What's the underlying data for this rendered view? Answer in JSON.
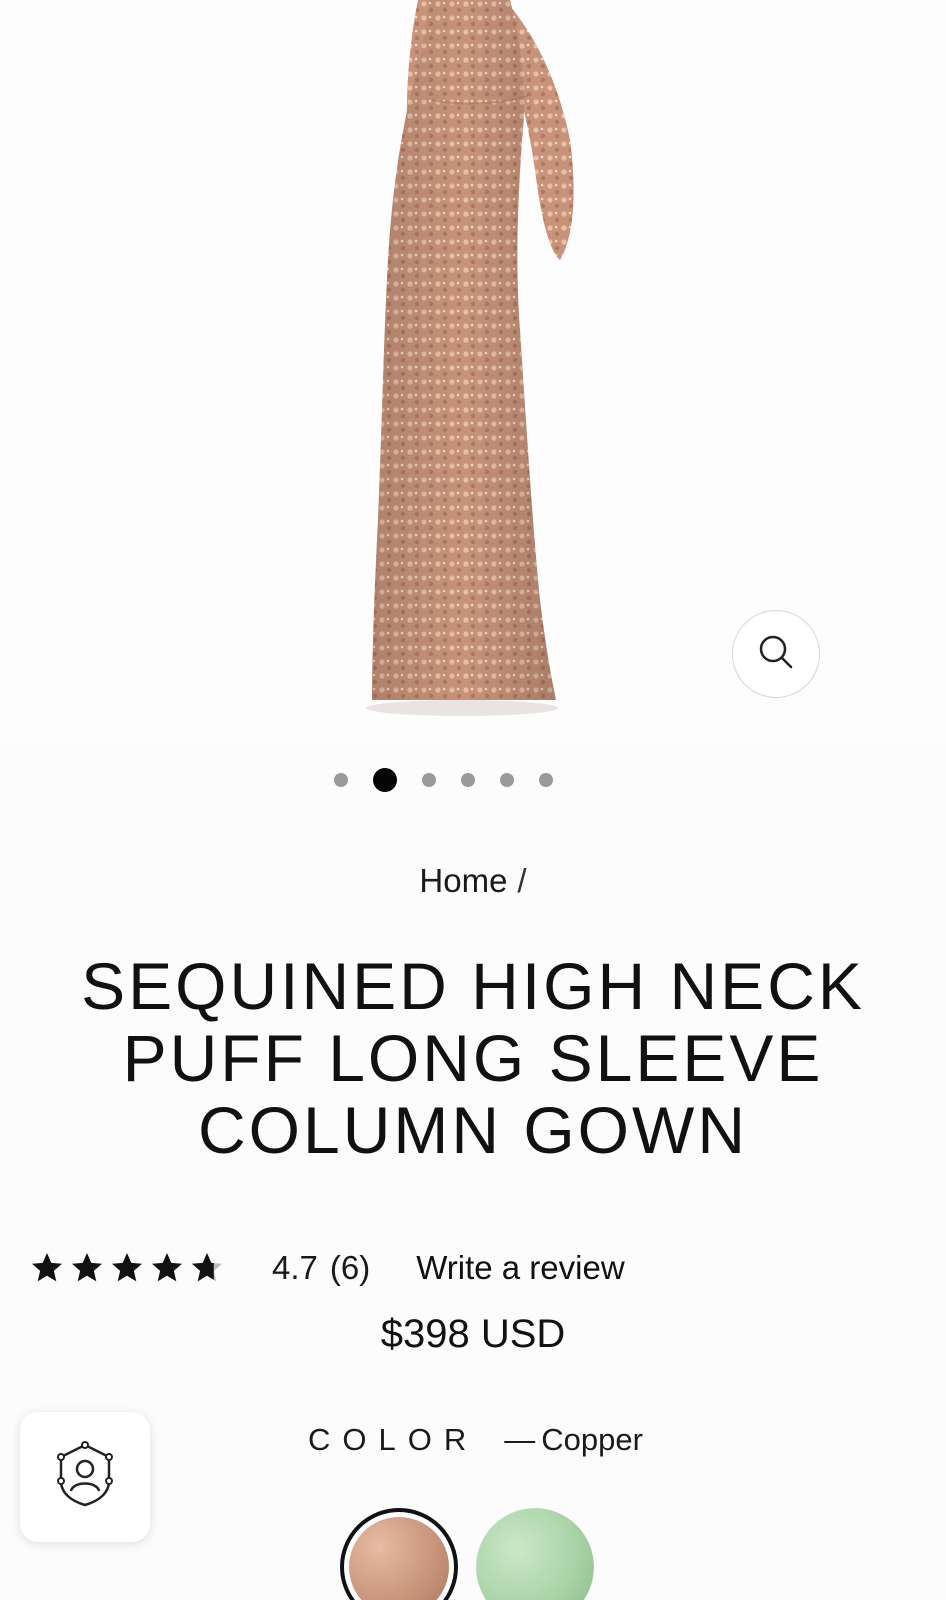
{
  "product": {
    "image_alt": "Copper sequined gown, back view",
    "gallery": {
      "total": 6,
      "active_index": 1
    }
  },
  "breadcrumb": {
    "home_label": "Home",
    "separator": "/"
  },
  "title": "SEQUINED HIGH NECK PUFF LONG SLEEVE COLUMN GOWN",
  "rating": {
    "stars": 4.7,
    "value_text": "4.7",
    "count_text": "(6)",
    "write_review_label": "Write a review"
  },
  "price": "$398 USD",
  "color": {
    "label": "COLOR",
    "dash": "—",
    "selected_name": "Copper",
    "swatches": [
      {
        "name": "Copper",
        "hex": "#c9957b",
        "selected": true
      },
      {
        "name": "Sage",
        "hex": "#a8d3a6",
        "selected": false
      }
    ]
  },
  "icons": {
    "zoom": "search-icon",
    "account": "user-shield-icon"
  },
  "colors": {
    "accent": "#111111",
    "dot_inactive": "#9a9a9a",
    "gown": "#c7937a"
  }
}
